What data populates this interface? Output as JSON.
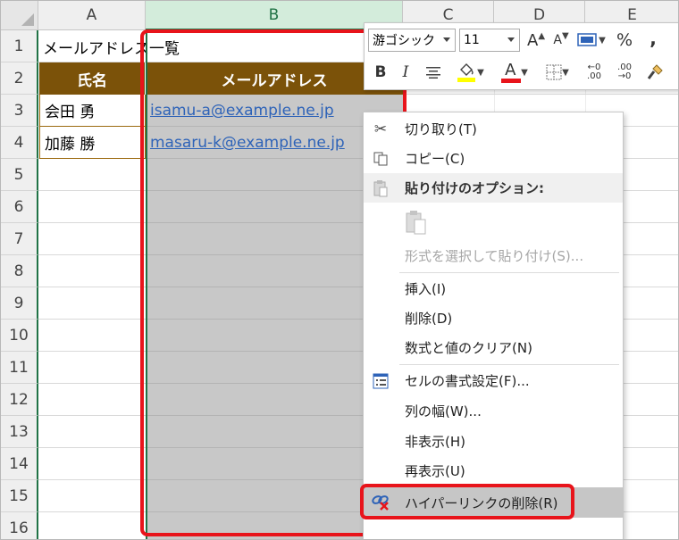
{
  "columns": [
    "A",
    "B",
    "C",
    "D",
    "E"
  ],
  "rows": [
    "1",
    "2",
    "3",
    "4",
    "5",
    "6",
    "7",
    "8",
    "9",
    "10",
    "11",
    "12",
    "13",
    "14",
    "15",
    "16"
  ],
  "cells": {
    "a1": "メールアドレス一覧",
    "a2": "氏名",
    "b2": "メールアドレス",
    "a3": "会田 勇",
    "b3": "isamu-a@example.ne.jp",
    "a4": "加藤 勝",
    "b4": "masaru-k@example.ne.jp"
  },
  "mini_toolbar": {
    "font_name": "游ゴシック",
    "font_size": "11",
    "grow_font": "A",
    "shrink_font": "A",
    "percent": "%",
    "comma": ",",
    "bold": "B",
    "italic": "I",
    "font_color_letter": "A",
    "decimal_increase": ".00",
    "decimal_decrease": ".00"
  },
  "context_menu": {
    "items": [
      {
        "label": "切り取り(T)",
        "icon": "scissors-icon"
      },
      {
        "label": "コピー(C)",
        "icon": "copy-icon"
      },
      {
        "label": "貼り付けのオプション:",
        "icon": "paste-icon"
      },
      {
        "label": "形式を選択して貼り付け(S)...",
        "icon": ""
      },
      {
        "label": "挿入(I)",
        "icon": ""
      },
      {
        "label": "削除(D)",
        "icon": ""
      },
      {
        "label": "数式と値のクリア(N)",
        "icon": ""
      },
      {
        "label": "セルの書式設定(F)...",
        "icon": "format-cells-icon"
      },
      {
        "label": "列の幅(W)...",
        "icon": ""
      },
      {
        "label": "非表示(H)",
        "icon": ""
      },
      {
        "label": "再表示(U)",
        "icon": ""
      },
      {
        "label": "ハイパーリンクの削除(R)",
        "icon": "remove-hyperlink-icon"
      }
    ]
  },
  "colors": {
    "header_fill": "#7b5209",
    "selection_fill": "#c8c8c8",
    "excel_green": "#217346",
    "highlight_red": "#e8141b",
    "link": "#2e63b8"
  }
}
